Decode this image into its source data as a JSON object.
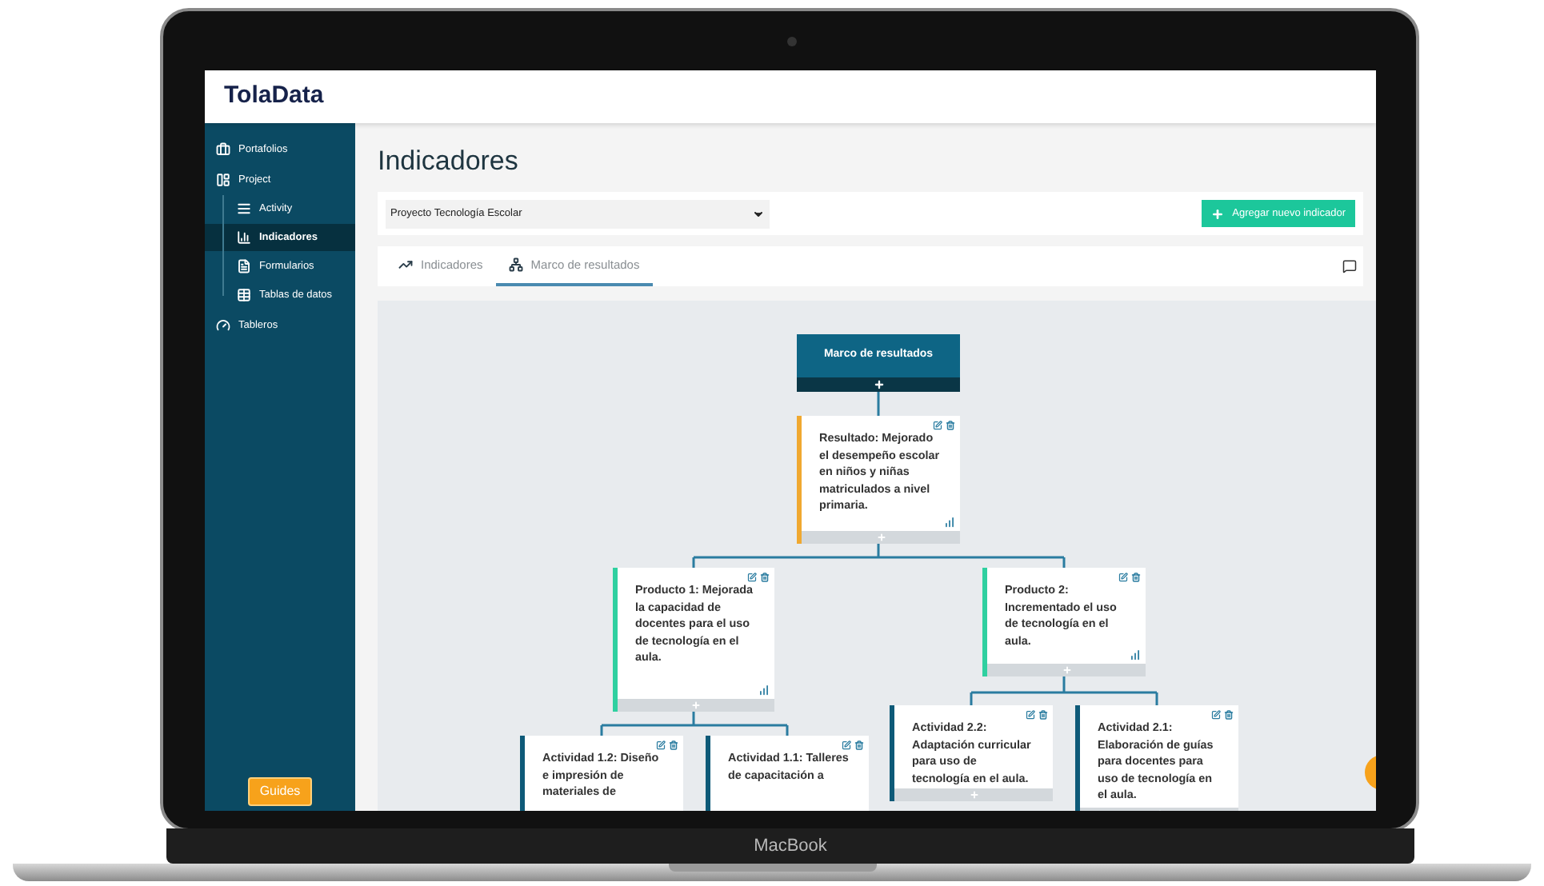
{
  "device_label": "MacBook",
  "app": {
    "logo": "TolaData"
  },
  "sidebar": {
    "items": [
      {
        "label": "Portafolios",
        "selected": false
      },
      {
        "label": "Project",
        "selected": false,
        "children": [
          {
            "label": "Activity",
            "selected": false
          },
          {
            "label": "Indicadores",
            "selected": true
          },
          {
            "label": "Formularios",
            "selected": false
          },
          {
            "label": "Tablas de datos",
            "selected": false
          }
        ]
      },
      {
        "label": "Tableros",
        "selected": false
      }
    ],
    "guides_button": "Guides"
  },
  "page_title": "Indicadores",
  "project_select": {
    "value": "Proyecto Tecnología Escolar"
  },
  "add_button": "Agregar nuevo indicador",
  "tabs": [
    {
      "label": "Indicadores",
      "selected": false
    },
    {
      "label": "Marco de resultados",
      "selected": true
    }
  ],
  "results_framework": {
    "kind": "root",
    "text": "Marco de resultados",
    "children": [
      {
        "kind": "resultado",
        "text": "Resultado: Mejorado el desempeño escolar en niños y niñas matriculados a nivel primaria.",
        "children": [
          {
            "kind": "producto",
            "text": "Producto 1: Mejorada la capacidad de docentes para el uso de tecnología en el aula.",
            "children": [
              {
                "kind": "actividad",
                "text": "Actividad 1.2: Diseño e impresión de materiales de"
              },
              {
                "kind": "actividad",
                "text": "Actividad 1.1: Talleres de capacitación a"
              }
            ]
          },
          {
            "kind": "producto",
            "text": "Producto 2: Incrementado el uso de tecnología en el aula.",
            "children": [
              {
                "kind": "actividad",
                "text": "Actividad 2.2: Adaptación curricular para uso de tecnología en el aula."
              },
              {
                "kind": "actividad",
                "text": "Actividad 2.1: Elaboración de guías para docentes para uso de tecnología en el aula."
              }
            ]
          }
        ]
      }
    ]
  }
}
